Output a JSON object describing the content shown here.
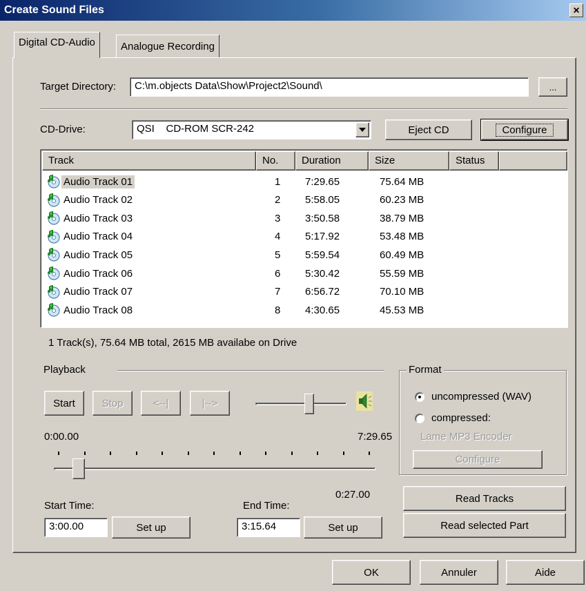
{
  "window": {
    "title": "Create Sound Files",
    "close_glyph": "×"
  },
  "tabs": [
    {
      "label": "Digital CD-Audio"
    },
    {
      "label": "Analogue Recording"
    }
  ],
  "target_directory": {
    "label": "Target Directory:",
    "value": "C:\\m.objects Data\\Show\\Project2\\Sound\\",
    "browse_label": "..."
  },
  "cd_drive": {
    "label": "CD-Drive:",
    "value": "QSI    CD-ROM SCR-242",
    "eject_label": "Eject CD",
    "configure_label": "Configure"
  },
  "track_list": {
    "columns": [
      "Track",
      "No.",
      "Duration",
      "Size",
      "Status"
    ],
    "rows": [
      {
        "track": "Audio Track 01",
        "no": "1",
        "duration": "7:29.65",
        "size": "75.64 MB",
        "status": ""
      },
      {
        "track": "Audio Track 02",
        "no": "2",
        "duration": "5:58.05",
        "size": "60.23 MB",
        "status": ""
      },
      {
        "track": "Audio Track 03",
        "no": "3",
        "duration": "3:50.58",
        "size": "38.79 MB",
        "status": ""
      },
      {
        "track": "Audio Track 04",
        "no": "4",
        "duration": "5:17.92",
        "size": "53.48 MB",
        "status": ""
      },
      {
        "track": "Audio Track 05",
        "no": "5",
        "duration": "5:59.54",
        "size": "60.49 MB",
        "status": ""
      },
      {
        "track": "Audio Track 06",
        "no": "6",
        "duration": "5:30.42",
        "size": "55.59 MB",
        "status": ""
      },
      {
        "track": "Audio Track 07",
        "no": "7",
        "duration": "6:56.72",
        "size": "70.10 MB",
        "status": ""
      },
      {
        "track": "Audio Track 08",
        "no": "8",
        "duration": "4:30.65",
        "size": "45.53 MB",
        "status": ""
      }
    ],
    "selected_row": 0
  },
  "summary": "1 Track(s), 75.64 MB total,  2615 MB availabe on Drive",
  "playback": {
    "label": "Playback",
    "start_label": "Start",
    "stop_label": "Stop",
    "prev_label": "<--|",
    "next_label": "|-->",
    "volume_level": 0.6,
    "speaker_icon": "speaker-icon",
    "time_start": "0:00.00",
    "time_end": "7:29.65",
    "position_fraction": 0.06,
    "current_time": "0:27.00"
  },
  "format": {
    "label": "Format",
    "uncompressed_label": "uncompressed (WAV)",
    "compressed_label": "compressed:",
    "encoder_label": "Lame MP3 Encoder",
    "configure_label": "Configure",
    "selected": "uncompressed"
  },
  "start_time": {
    "label": "Start Time:",
    "value": "3:00.00",
    "setup_label": "Set up"
  },
  "end_time": {
    "label": "End Time:",
    "value": "3:15.64",
    "setup_label": "Set up"
  },
  "actions": {
    "read_tracks": "Read Tracks",
    "read_selected": "Read selected Part"
  },
  "footer": {
    "ok": "OK",
    "cancel": "Annuler",
    "help": "Aide"
  },
  "colors": {
    "title_start": "#0a246a",
    "title_end": "#a6caf0",
    "face": "#d4d0c8"
  }
}
